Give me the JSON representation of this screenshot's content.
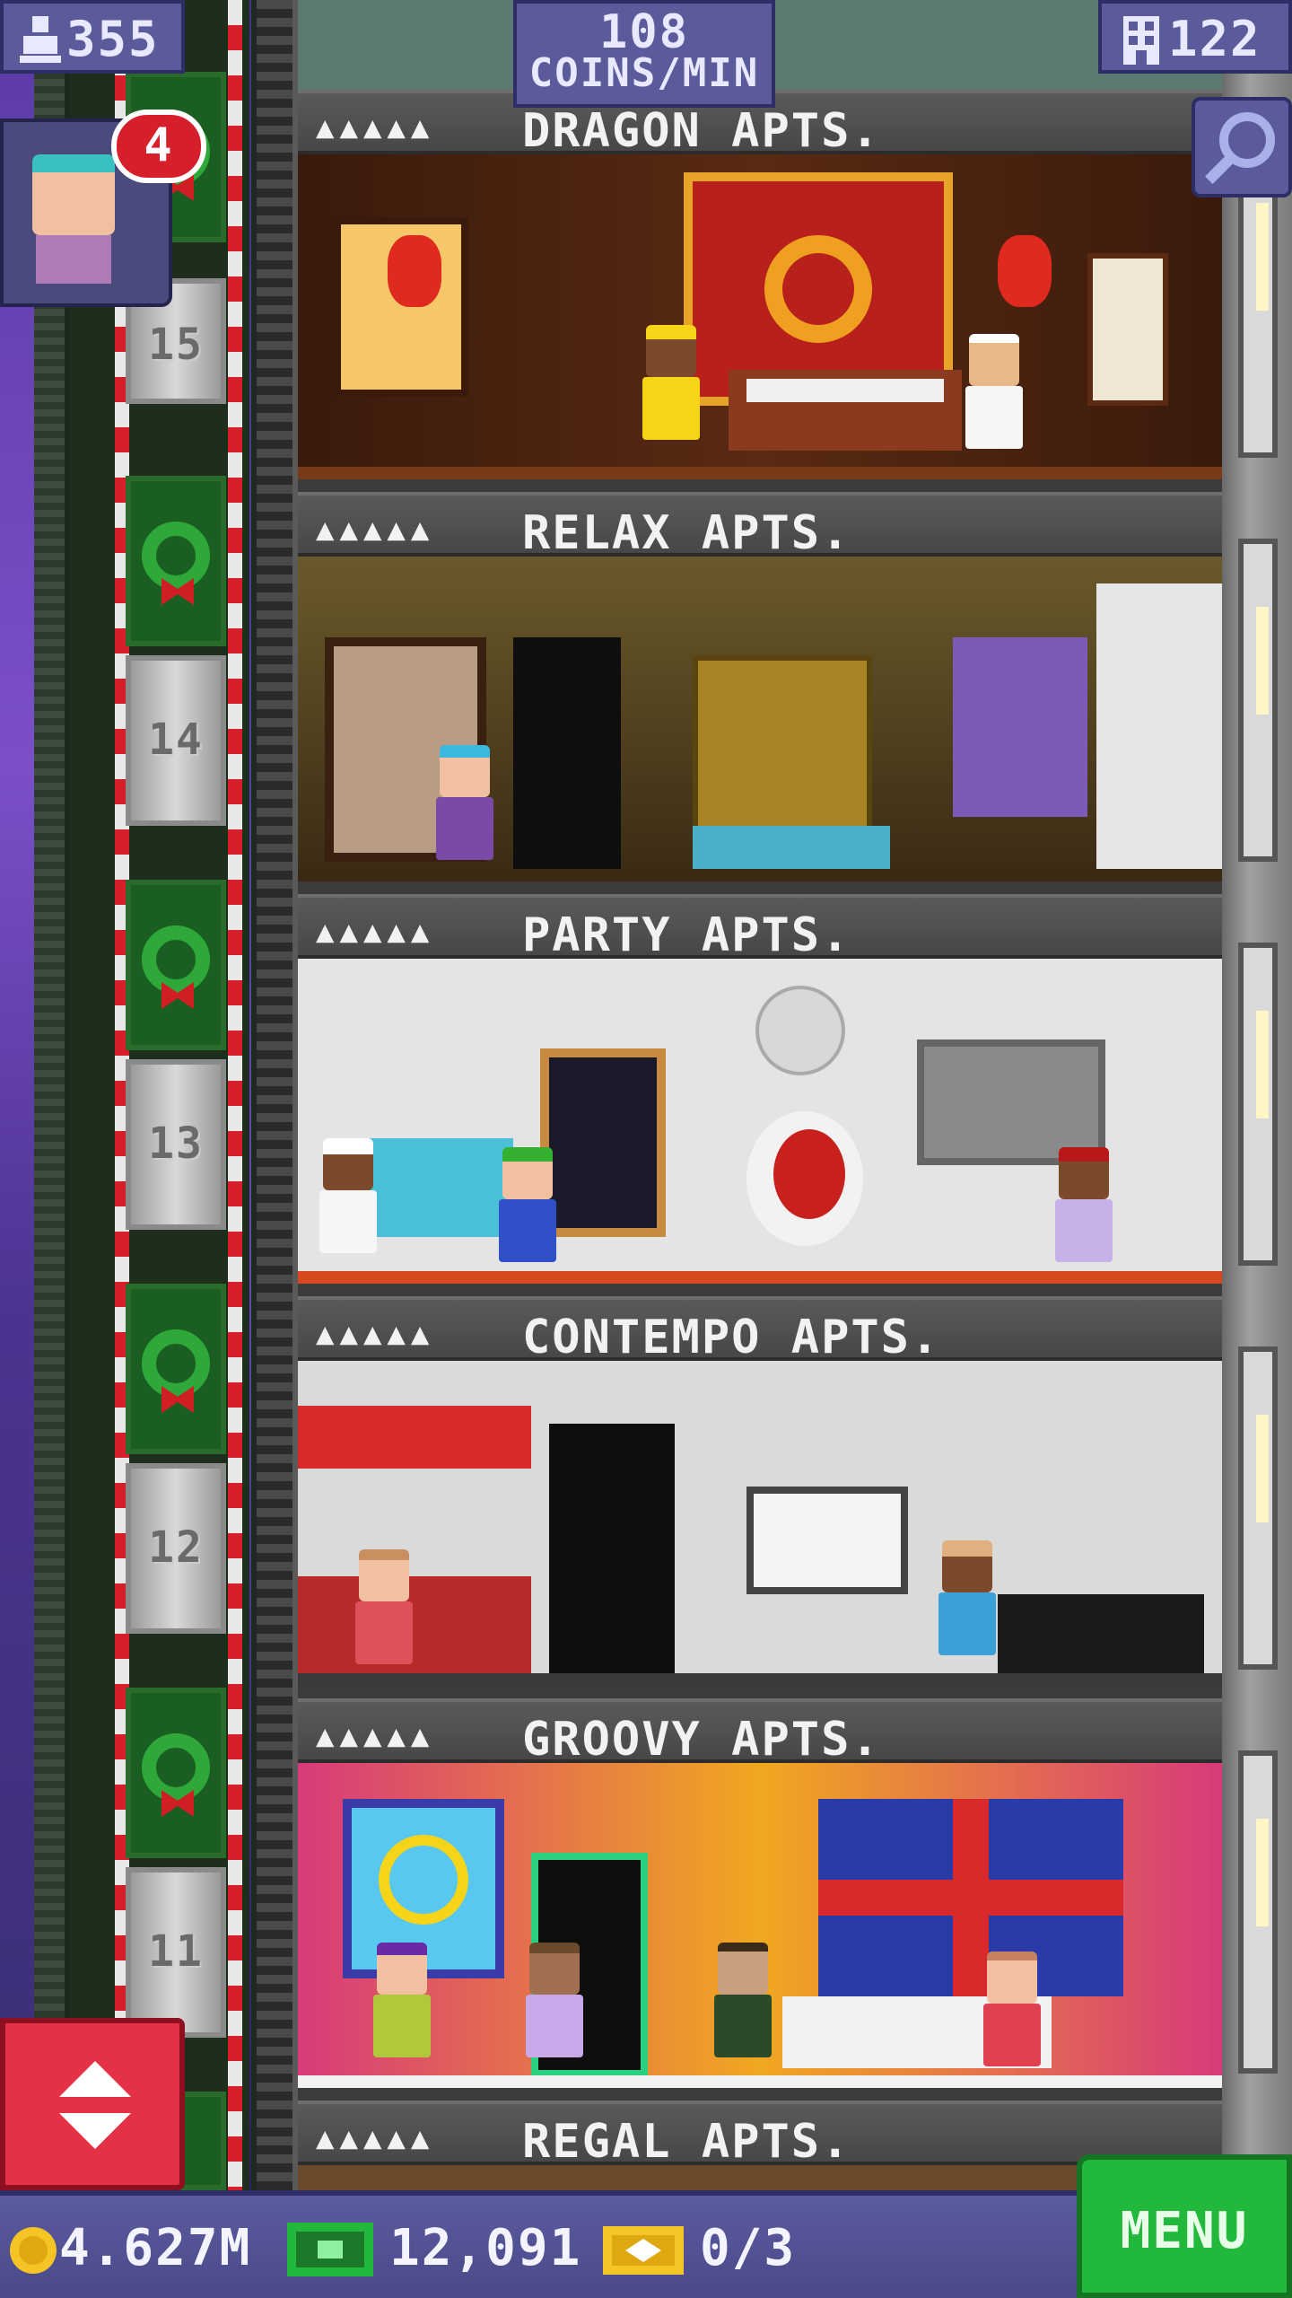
{
  "hud": {
    "population": "355",
    "coins_rate_number": "108",
    "coins_rate_unit": "COINS/MIN",
    "floor_count": "122",
    "notification_count": "4"
  },
  "shaft_floor_numbers": [
    "15",
    "14",
    "13",
    "12",
    "11"
  ],
  "floors": [
    {
      "name": "DRAGON APTS.",
      "stars": "▲▲▲▲▲"
    },
    {
      "name": "RELAX APTS.",
      "stars": "▲▲▲▲▲"
    },
    {
      "name": "PARTY APTS.",
      "stars": "▲▲▲▲▲"
    },
    {
      "name": "CONTEMPO APTS.",
      "stars": "▲▲▲▲▲"
    },
    {
      "name": "GROOVY APTS.",
      "stars": "▲▲▲▲▲"
    },
    {
      "name": "REGAL APTS.",
      "stars": "▲▲▲▲▲"
    }
  ],
  "bottom": {
    "coins": "4.627M",
    "bux": "12,091",
    "tickets": "0/3",
    "menu_label": "MENU"
  },
  "colors": {
    "coin": "#f5c526",
    "bux": "#22b83b",
    "ticket": "#f5c526",
    "menu": "#22b83b",
    "elevator_button": "#e53146",
    "badge": "#d61f2a"
  },
  "icons": {
    "population": "person-icon",
    "floors": "building-icon",
    "search": "magnifier-icon",
    "coins": "coin-icon",
    "bux": "bux-icon",
    "tickets": "ticket-icon",
    "elevator": "up-down-arrows-icon"
  }
}
